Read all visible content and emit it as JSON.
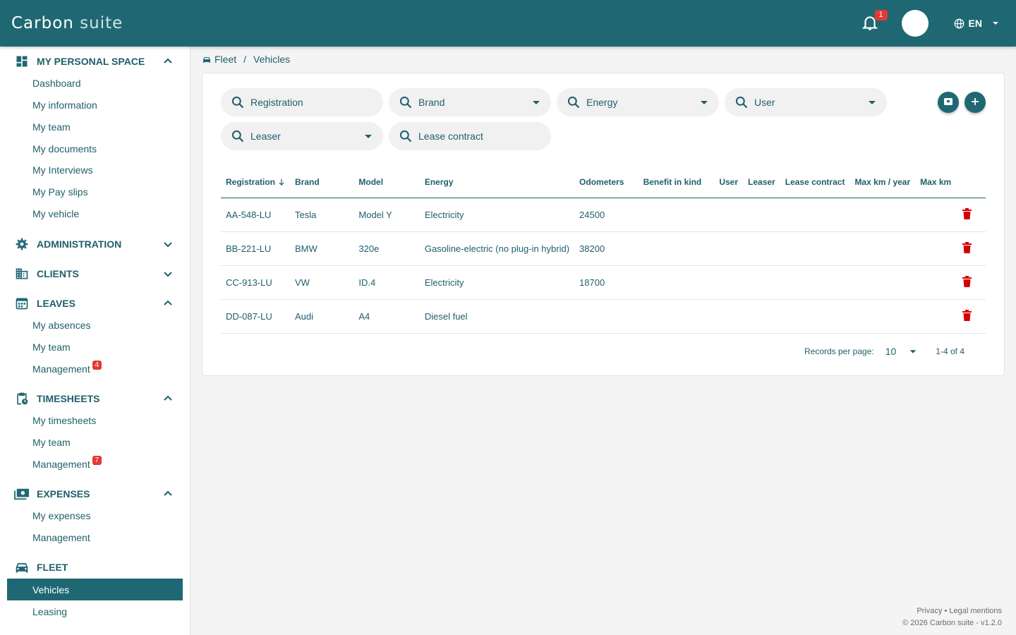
{
  "header": {
    "logo_main": "Carbon",
    "logo_suite": "suite",
    "notification_count": "1",
    "language": "EN"
  },
  "sidebar": {
    "personal": {
      "title": "MY PERSONAL SPACE",
      "items": [
        "Dashboard",
        "My information",
        "My team",
        "My documents",
        "My Interviews",
        "My Pay slips",
        "My vehicle"
      ]
    },
    "administration": {
      "title": "ADMINISTRATION"
    },
    "clients": {
      "title": "CLIENTS"
    },
    "leaves": {
      "title": "LEAVES",
      "items": [
        "My absences",
        "My team",
        "Management"
      ],
      "management_badge": "4"
    },
    "timesheets": {
      "title": "TIMESHEETS",
      "items": [
        "My timesheets",
        "My team",
        "Management"
      ],
      "management_badge": "7"
    },
    "expenses": {
      "title": "EXPENSES",
      "items": [
        "My expenses",
        "Management"
      ]
    },
    "fleet": {
      "title": "FLEET",
      "items": [
        "Vehicles",
        "Leasing"
      ]
    }
  },
  "breadcrumb": {
    "parent": "Fleet",
    "separator": "/",
    "current": "Vehicles"
  },
  "filters": {
    "registration": "Registration",
    "brand": "Brand",
    "energy": "Energy",
    "user": "User",
    "leaser": "Leaser",
    "lease_contract": "Lease contract"
  },
  "table": {
    "columns": [
      "Registration",
      "Brand",
      "Model",
      "Energy",
      "Odometers",
      "Benefit in kind",
      "User",
      "Leaser",
      "Lease contract",
      "Max km / year",
      "Max km"
    ],
    "rows": [
      {
        "registration": "AA-548-LU",
        "brand": "Tesla",
        "model": "Model Y",
        "energy": "Electricity",
        "odometers": "24500"
      },
      {
        "registration": "BB-221-LU",
        "brand": "BMW",
        "model": "320e",
        "energy": "Gasoline-electric (no plug-in hybrid)",
        "odometers": "38200"
      },
      {
        "registration": "CC-913-LU",
        "brand": "VW",
        "model": "ID.4",
        "energy": "Electricity",
        "odometers": "18700"
      },
      {
        "registration": "DD-087-LU",
        "brand": "Audi",
        "model": "A4",
        "energy": "Diesel fuel",
        "odometers": ""
      }
    ]
  },
  "pagination": {
    "label": "Records per page:",
    "per_page": "10",
    "range": "1-4 of 4"
  },
  "footer": {
    "privacy": "Privacy",
    "dot": "•",
    "legal": "Legal mentions",
    "copyright": "© 2026 Carbon suite - v1.2.0"
  },
  "colors": {
    "primary": "#1f6873",
    "text": "#1f5f6b",
    "danger": "#e53935",
    "delete_icon": "#d50000"
  }
}
